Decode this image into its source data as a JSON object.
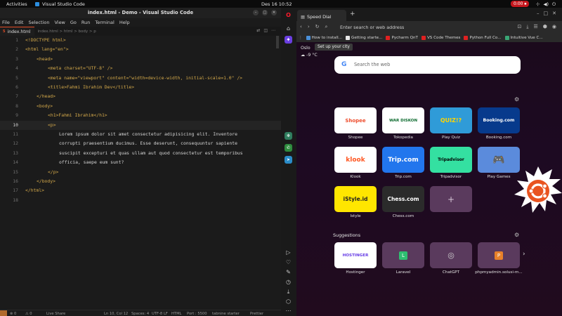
{
  "topbar": {
    "activities": "Activities",
    "app_name": "Visual Studio Code",
    "clock": "Des 16  10:52",
    "recording": "0:00"
  },
  "vscode": {
    "title": "index.html - Demo - Visual Studio Code",
    "menu": [
      "File",
      "Edit",
      "Selection",
      "View",
      "Go",
      "Run",
      "Terminal",
      "Help"
    ],
    "tab": {
      "label": "index.html",
      "breadcrumb": "index.html > html > body > p"
    },
    "lines": [
      {
        "n": "1"
      },
      {
        "n": "2"
      },
      {
        "n": "3"
      },
      {
        "n": "4"
      },
      {
        "n": "5"
      },
      {
        "n": "6"
      },
      {
        "n": "7"
      },
      {
        "n": "8"
      },
      {
        "n": "9"
      },
      {
        "n": "10"
      },
      {
        "n": "11"
      },
      {
        "n": "12"
      },
      {
        "n": "13"
      },
      {
        "n": "14"
      },
      {
        "n": "15"
      },
      {
        "n": "16"
      },
      {
        "n": "17"
      },
      {
        "n": "18"
      }
    ],
    "code": {
      "doctype": "<!DOCTYPE html>",
      "html_open": "<html lang=\"en\">",
      "head_open": "<head>",
      "meta_charset": "<meta charset=\"UTF-8\" />",
      "meta_viewport": "<meta name=\"viewport\" content=\"width=device-width, initial-scale=1.0\" />",
      "title": "<title>Fahmi Ibrahim Dev</title>",
      "head_close": "</head>",
      "body_open": "<body>",
      "h1": "<h1>Fahmi Ibrahim</h1>",
      "p_open": "<p>",
      "p_text_1": "Lorem ipsum dolor sit amet consectetur adipisicing elit. Inventore",
      "p_text_2": "corrupti praesentium ducimus. Esse deserunt, consequuntur sapiente",
      "p_text_3": "suscipit excepturi et quas ullam aut quod consectetur est temporibus",
      "p_text_4": "officia, saepe eum sunt?",
      "p_close": "</p>",
      "body_close": "</body>",
      "html_close": "</html>"
    },
    "status": {
      "errors": "⊗ 0",
      "warnings": "⚠ 0",
      "live_share": "Live Share",
      "cursor": "Ln 10, Col 12",
      "spaces": "Spaces: 4",
      "encoding": "UTF-8",
      "eol": "LF",
      "language": "HTML",
      "port": "Port : 5500",
      "tabnine": "tabnine starter",
      "prettier": "Prettier"
    }
  },
  "opera": {
    "tab_label": "Speed Dial",
    "address_placeholder": "Enter search or web address",
    "bookmarks": [
      {
        "label": "How to install...",
        "color": "#4a90d9"
      },
      {
        "label": "Getting starte...",
        "color": "#e8e8e8"
      },
      {
        "label": "Pycharm QnT",
        "color": "#e02020"
      },
      {
        "label": "VS Code Themes",
        "color": "#e02020"
      },
      {
        "label": "Python Full Co...",
        "color": "#e02020"
      },
      {
        "label": "Intuitive Vue C...",
        "color": "#3aa675"
      }
    ],
    "weather_city": "Oslo",
    "weather_cta": "Set up your city",
    "weather_temp": "-9 °C",
    "search_placeholder": "Search the web",
    "speed_dial": [
      {
        "label": "Shopee",
        "text": "Shopee",
        "bg": "#ffffff",
        "fg": "#ee4d2d"
      },
      {
        "label": "Tokopedia",
        "text": "WAR DISKON",
        "bg": "#ffffff",
        "fg": "#0d6b2f"
      },
      {
        "label": "Play Quiz",
        "text": "QUIZ!?",
        "bg": "#2f9bd8",
        "fg": "#ffd400"
      },
      {
        "label": "Booking.com",
        "text": "Booking.com",
        "bg": "#073a8c",
        "fg": "#ffffff"
      },
      {
        "label": "Klook",
        "text": "klook",
        "bg": "#ffffff",
        "fg": "#ff5722"
      },
      {
        "label": "Trip.com",
        "text": "Trip.com",
        "bg": "#2276ed",
        "fg": "#ffffff"
      },
      {
        "label": "Tripadvisor",
        "text": "Tripadvisor",
        "bg": "#34e0a1",
        "fg": "#000000"
      },
      {
        "label": "Play Games",
        "text": "🎮",
        "bg": "#5b8bdc",
        "fg": "#ffffff"
      },
      {
        "label": "Istyle",
        "text": "iStyle.id",
        "bg": "#ffe600",
        "fg": "#222222"
      },
      {
        "label": "Chess.com",
        "text": "Chess.com",
        "bg": "#2b2b2b",
        "fg": "#ffffff"
      },
      {
        "label": "",
        "text": "+",
        "bg": "#5a3a5d",
        "fg": "#d6c6d6"
      }
    ],
    "suggestions_title": "Suggestions",
    "suggestions": [
      {
        "label": "Hostinger",
        "text": "HOSTINGER",
        "bg": "#ffffff",
        "fg": "#673de6"
      },
      {
        "label": "Laravel",
        "text": "L",
        "bg": "#5a3a5d",
        "fg": "#ffffff",
        "chip": "#2fbf71"
      },
      {
        "label": "ChatGPT",
        "text": "◎",
        "bg": "#5a3a5d",
        "fg": "#cfcfcf"
      },
      {
        "label": "phpmyadmin.solusi-m...",
        "text": "P",
        "bg": "#5a3a5d",
        "fg": "#ffffff",
        "chip": "#e8812a"
      }
    ]
  }
}
